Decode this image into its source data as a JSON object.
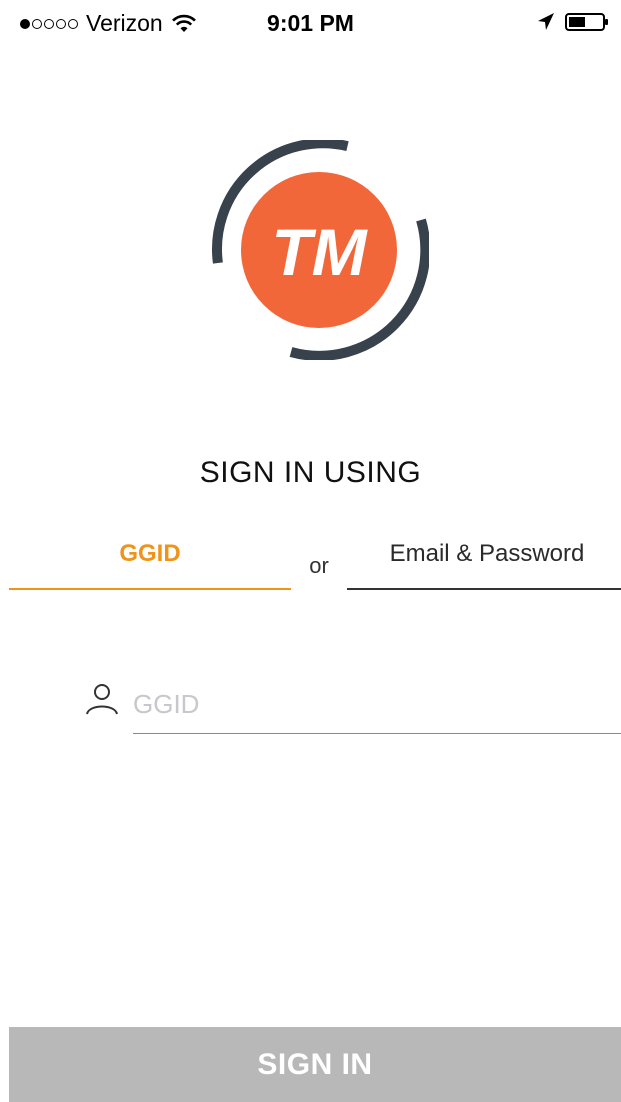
{
  "status_bar": {
    "carrier": "Verizon",
    "time": "9:01 PM",
    "signal_bars_filled": 1,
    "signal_bars_total": 5
  },
  "logo": {
    "text": "TM",
    "brand_color": "#F26739",
    "ring_color": "#37424C"
  },
  "heading": "SIGN IN USING",
  "tabs": {
    "ggid_label": "GGID",
    "separator": "or",
    "email_label": "Email & Password",
    "active": "GGID",
    "active_color": "#F0931A"
  },
  "ggid_field": {
    "value": "",
    "placeholder": "GGID"
  },
  "sign_in_button": {
    "label": "SIGN IN",
    "color": "#B8B8B8"
  }
}
